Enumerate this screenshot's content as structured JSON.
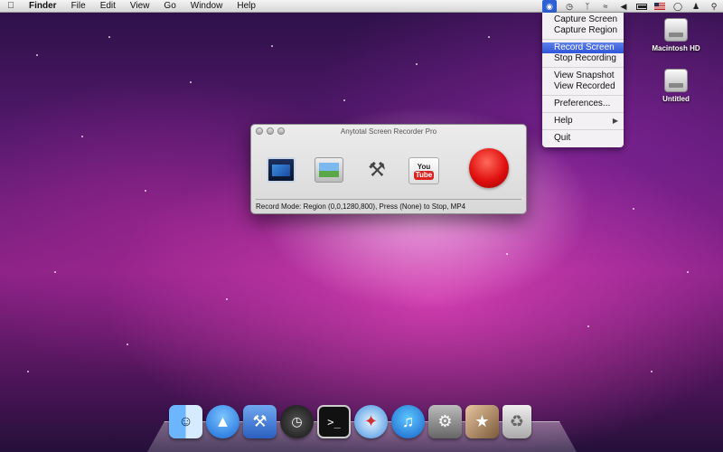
{
  "menubar": {
    "apple_icon": "apple-icon",
    "items": [
      "Finder",
      "File",
      "Edit",
      "View",
      "Go",
      "Window",
      "Help"
    ],
    "tray_icons": [
      "screen-recorder-icon",
      "time-machine-icon",
      "bluetooth-icon",
      "wifi-icon",
      "volume-icon",
      "battery-icon",
      "flag-icon",
      "clock-icon",
      "user-icon",
      "spotlight-icon"
    ]
  },
  "dropdown": {
    "items": [
      {
        "label": "Capture Screen"
      },
      {
        "label": "Capture Region"
      },
      {
        "label": "Record Screen",
        "highlighted": true
      },
      {
        "label": "Stop Recording"
      },
      {
        "label": "View Snapshot"
      },
      {
        "label": "View Recorded"
      },
      {
        "label": "Preferences..."
      },
      {
        "label": "Help",
        "submenu": true
      },
      {
        "label": "Quit"
      }
    ]
  },
  "desktop": {
    "icons": [
      {
        "label": "Macintosh HD"
      },
      {
        "label": "Untitled"
      }
    ]
  },
  "window": {
    "title": "Anytotal Screen Recorder Pro",
    "tools": [
      "record-screen-icon",
      "capture-image-icon",
      "tools-icon",
      "youtube-icon"
    ],
    "youtube_you": "You",
    "youtube_tube": "Tube",
    "status": "Record Mode: Region (0,0,1280,800), Press (None) to Stop, MP4"
  },
  "dock": {
    "apps": [
      "finder",
      "app-store",
      "xcode",
      "dashboard",
      "terminal",
      "safari",
      "itunes",
      "system-preferences",
      "iphoto",
      "trash"
    ]
  },
  "colors": {
    "highlight": "#2f56d8",
    "record_button": "#e01010"
  }
}
